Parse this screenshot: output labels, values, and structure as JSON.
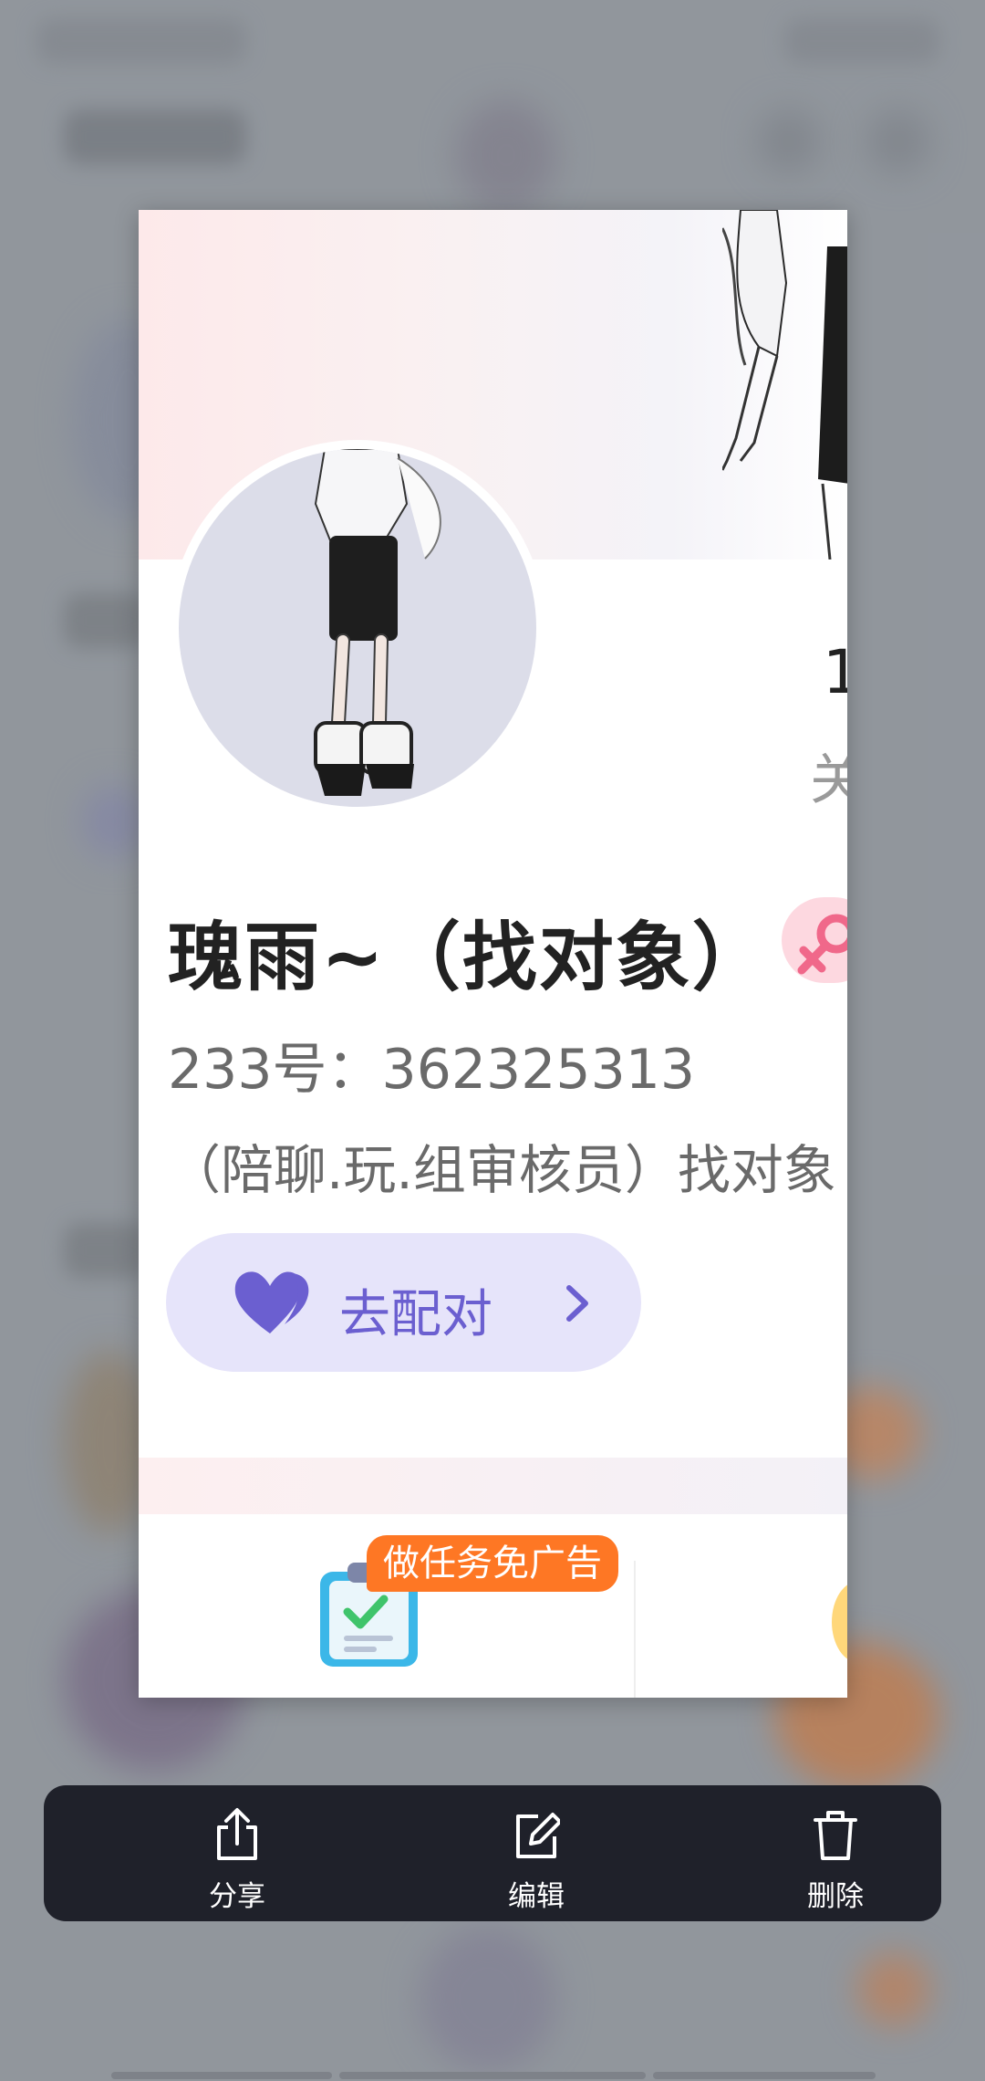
{
  "profile": {
    "name": "瑰雨~（找对象）",
    "uid": "233号：362325313",
    "bio": "（陪聊.玩.组审核员）找对象",
    "stat_value": "1",
    "stat_label": "关",
    "match_label": "去配对",
    "task_tag": "做任务免广告"
  },
  "actions": [
    {
      "label": "分享",
      "icon": "share-icon"
    },
    {
      "label": "编辑",
      "icon": "edit-icon"
    },
    {
      "label": "删除",
      "icon": "trash-icon"
    }
  ],
  "colors": {
    "accent_purple": "#6b5fd0",
    "match_bg": "#e6e4fa",
    "task_orange": "#fe7724",
    "action_bar_bg": "#1f212a",
    "gender_pink": "#f0688a"
  }
}
